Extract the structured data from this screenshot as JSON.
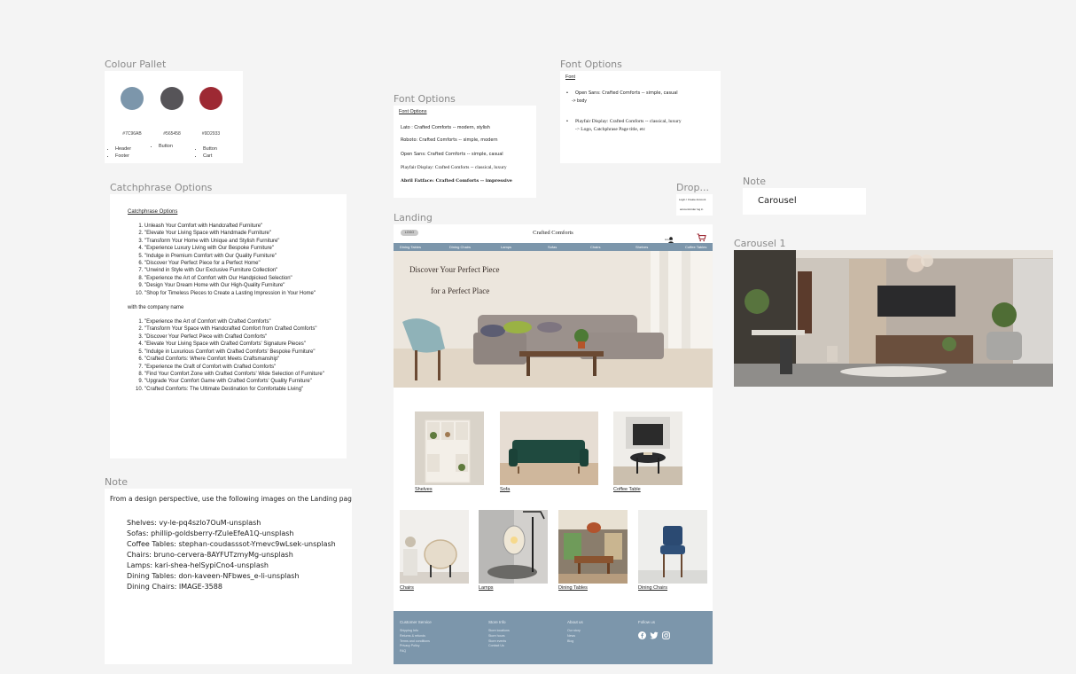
{
  "colour_pallet": {
    "label": "Colour Pallet",
    "swatches": [
      {
        "hex": "#7C96AB",
        "color": "#7C96AB",
        "uses": [
          "Header",
          "Footer"
        ]
      },
      {
        "hex": "#565458",
        "color": "#565458",
        "uses": [
          "Button"
        ]
      },
      {
        "hex": "#9D2933",
        "color": "#9D2933",
        "uses": [
          "Button",
          "Cart"
        ]
      }
    ]
  },
  "font_options_1": {
    "label": "Font Options",
    "heading": "Font Options",
    "lines": [
      "Lato : Crafted Comforts  -- modern, stylish",
      "Roboto: Crafted Comforts -- simple, modern",
      "Open Sans: Crafted Comforts -- simple, casual",
      "Playfair Display: Crafted Comforts -- classical, luxury",
      "Abril Fatface: Crafted Comforts -- impressive"
    ]
  },
  "font_options_2": {
    "label": "Font Options",
    "heading": "Font",
    "item1": "Open Sans:    Crafted Comforts -- simple, casual",
    "item1_note": "-> body",
    "item2": "Playfair Display:    Crafted Comforts -- classical, luxury",
    "item2_note": "-> Logo, Catchphrase Page title, etc"
  },
  "dropdown": {
    "label": "Drop...",
    "item1": "Login / Create Account",
    "item2": "account/order log in"
  },
  "note_carousel": {
    "label": "Note",
    "text": "Carousel"
  },
  "carousel1": {
    "label": "Carousel 1"
  },
  "catchphrase": {
    "label": "Catchphrase Options",
    "heading": "Catchphrase Options",
    "list1": [
      "Unleash Your Comfort with Handcrafted Furniture\"",
      "\"Elevate Your Living Space with Handmade Furniture\"",
      "\"Transform Your Home with Unique and Stylish Furniture\"",
      "\"Experience Luxury Living with Our Bespoke Furniture\"",
      "\"Indulge in Premium Comfort with Our Quality Furniture\"",
      "\"Discover Your Perfect Piece for a Perfect Home\"",
      "\"Unwind in Style with Our Exclusive Furniture Collection\"",
      "\"Experience the Art of Comfort with Our Handpicked Selection\"",
      "\"Design Your Dream Home with Our High-Quality Furniture\"",
      "\"Shop for Timeless Pieces to Create a Lasting Impression in Your Home\""
    ],
    "middle": "with the company name",
    "list2": [
      "\"Experience the Art of Comfort with Crafted Comforts\"",
      "\"Transform Your Space with Handcrafted Comfort from Crafted Comforts\"",
      "\"Discover Your Perfect Piece with Crafted Comforts\"",
      "\"Elevate Your Living Space with Crafted Comforts' Signature Pieces\"",
      "\"Indulge in Luxurious Comfort with Crafted Comforts' Bespoke Furniture\"",
      "\"Crafted Comforts: Where Comfort Meets Craftsmanship\"",
      "\"Experience the Craft of Comfort with Crafted Comforts\"",
      "\"Find Your Comfort Zone with Crafted Comforts' Wide Selection of Furniture\"",
      "\"Upgrade Your Comfort Game with Crafted Comforts' Quality Furniture\"",
      "\"Crafted Comforts: The Ultimate Destination for Comfortable Living\""
    ]
  },
  "note_images": {
    "label": "Note",
    "intro": "From a design perspective, use the following images on the Landing page.",
    "lines": [
      "Shelves: vy-le-pq4szlo7OuM-unsplash",
      "Sofas: phillip-goldsberry-fZuleEfeA1Q-unsplash",
      "Coffee Tables: stephan-coudasssot-Ymevc9wLsek-unsplash",
      "Chairs: bruno-cervera-8AYFUTzmyMg-unsplash",
      "Lamps: kari-shea-helSypiCno4-unsplash",
      "Dining Tables: don-kaveen-NFbwes_e-li-unsplash",
      "Dining Chairs: IMAGE-3588"
    ]
  },
  "landing": {
    "label": "Landing",
    "logo": "LOGO",
    "brand": "Crafted Comforts",
    "account_label": "Account",
    "nav": [
      "Dining Tables",
      "Dining Chairs",
      "Lamps",
      "Sofas",
      "Chairs",
      "Shelves",
      "Coffee Tables"
    ],
    "hero_line1": "Discover Your Perfect Piece",
    "hero_line2": "for a Perfect Place",
    "products": [
      "Shelves",
      "Sofa",
      "Coffee Table",
      "Chairs",
      "Lamps",
      "Dining Tables",
      "Dining Chairs"
    ],
    "footer": {
      "col1_title": "Customer Service",
      "col1_links": [
        "Shipping Info",
        "Returns & refunds",
        "Terms and conditions",
        "Privacy Policy",
        "FAQ"
      ],
      "col2_title": "Store Info",
      "col2_links": [
        "Store locations",
        "Store hours",
        "Store events",
        "Contact Us"
      ],
      "col3_title": "About us",
      "col3_links": [
        "Our story",
        "News",
        "Blog"
      ],
      "col4_title": "Follow us"
    }
  },
  "colors": {
    "canvas": "#f4f4f4",
    "brand_blue": "#7C96AB",
    "charcoal": "#565458",
    "red": "#9D2933"
  }
}
